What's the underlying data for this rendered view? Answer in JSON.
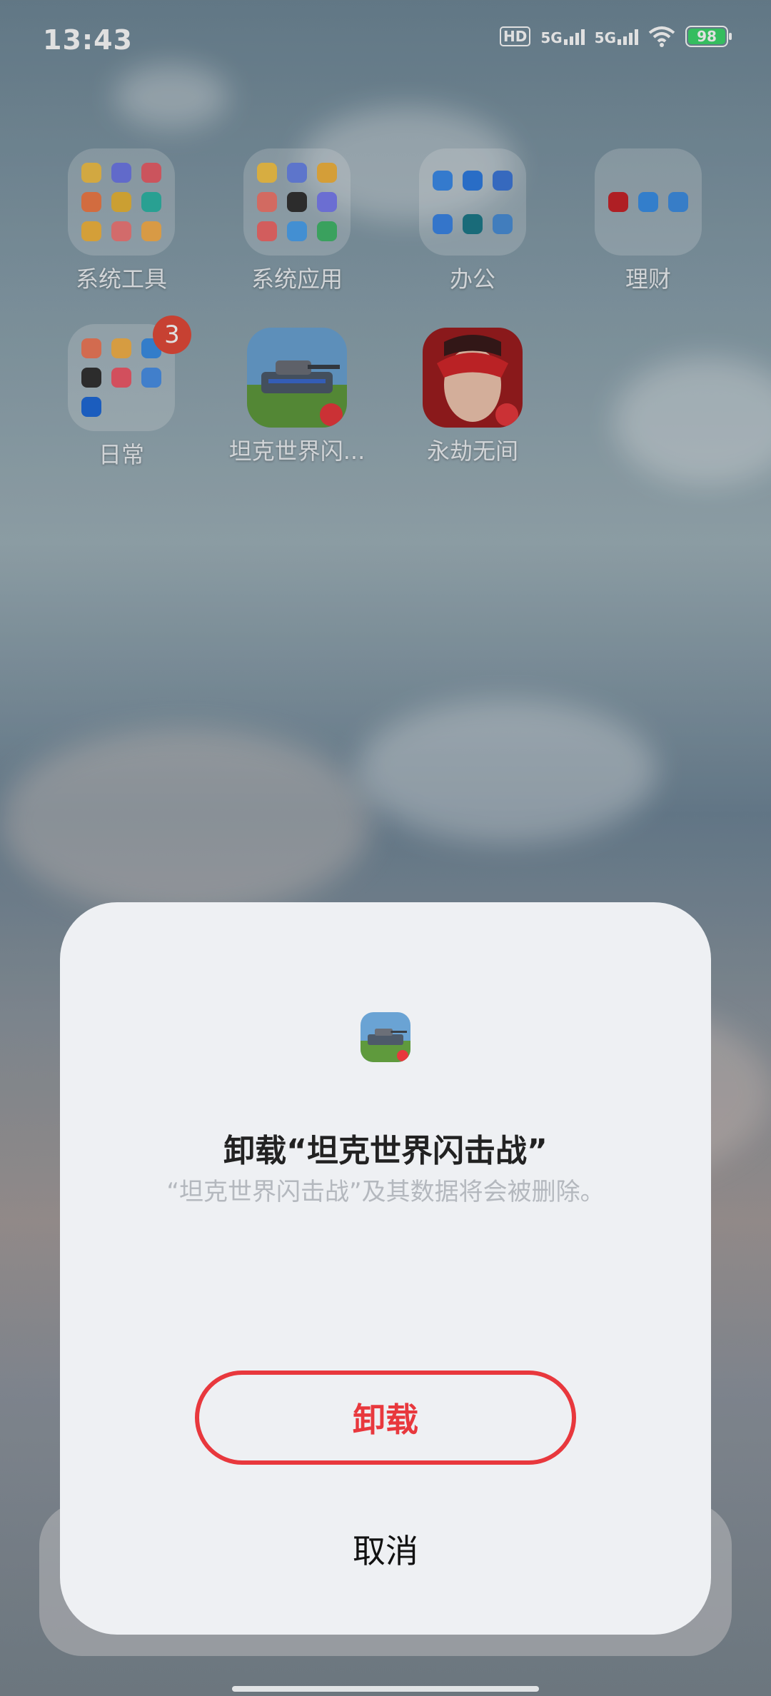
{
  "status_bar": {
    "time": "13:43",
    "hd_label": "HD",
    "sim1": "5G",
    "sim2": "5G",
    "battery": "98"
  },
  "home": {
    "apps": [
      {
        "label": "系统工具",
        "type": "folder"
      },
      {
        "label": "系统应用",
        "type": "folder"
      },
      {
        "label": "办公",
        "type": "folder"
      },
      {
        "label": "理财",
        "type": "folder"
      },
      {
        "label": "日常",
        "type": "folder",
        "badge": "3"
      },
      {
        "label": "坦克世界闪...",
        "type": "app",
        "icon": "tank-game-icon"
      },
      {
        "label": "永劫无间",
        "type": "app",
        "icon": "naraka-game-icon"
      }
    ]
  },
  "dialog": {
    "title": "卸载“坦克世界闪击战”",
    "message": "“坦克世界闪击战”及其数据将会被删除。",
    "uninstall_label": "卸载",
    "cancel_label": "取消",
    "accent_color": "#e8383d"
  }
}
